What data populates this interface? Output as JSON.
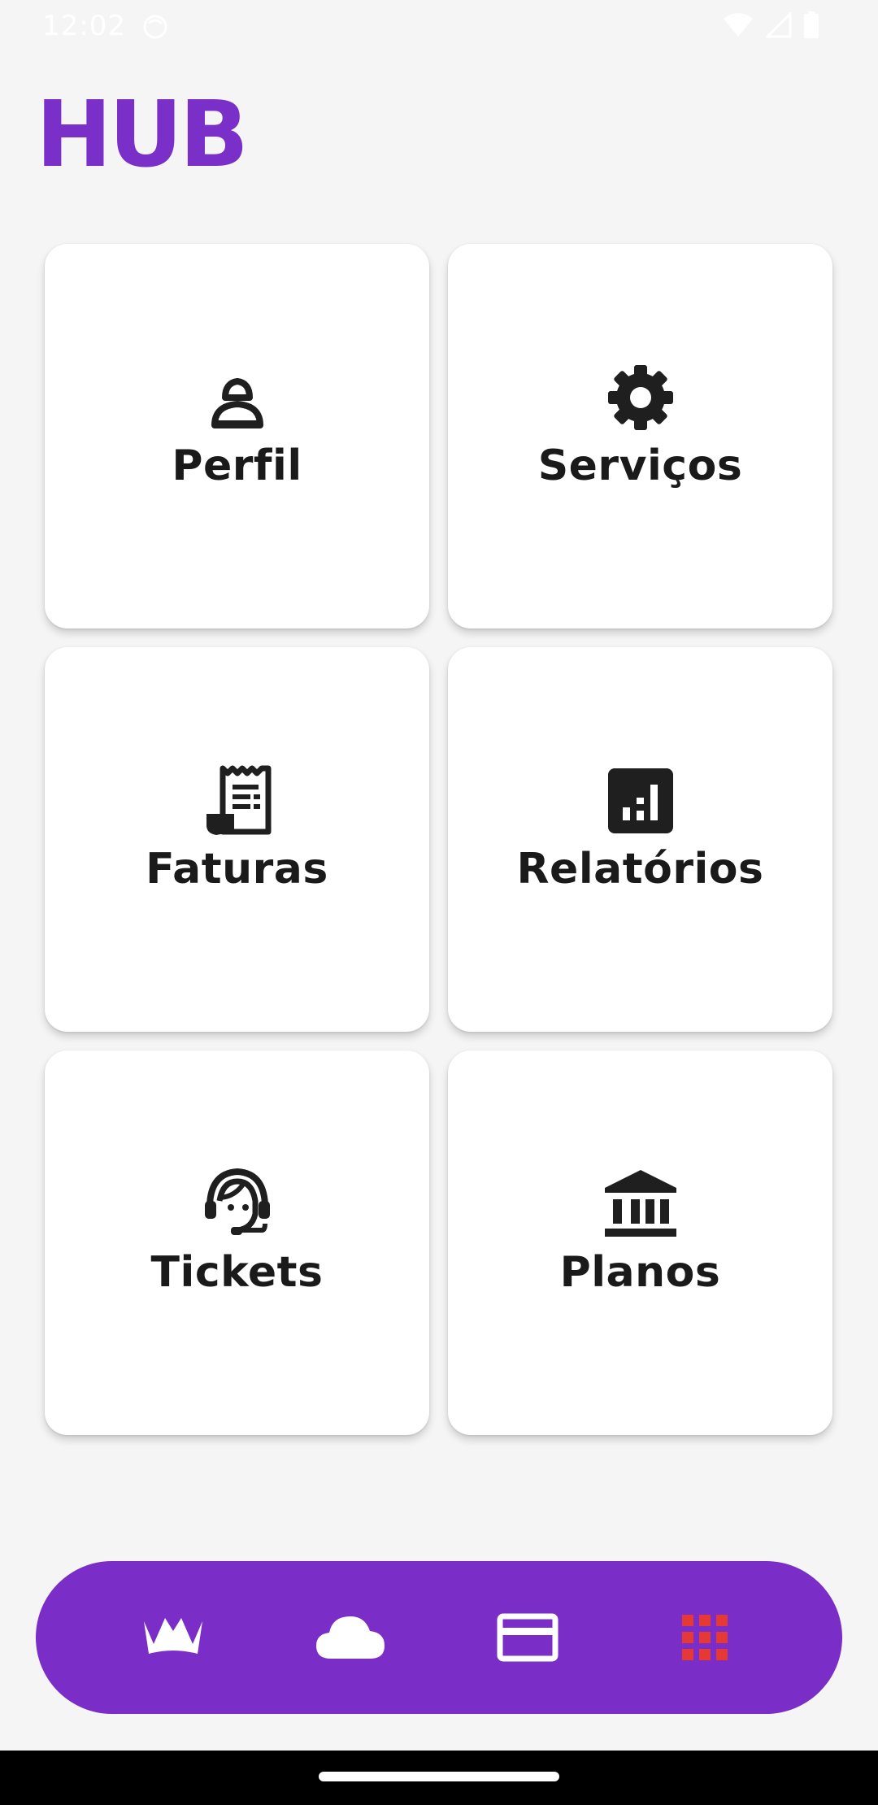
{
  "status_bar": {
    "time": "12:02",
    "icons": [
      "face-icon",
      "wifi-icon",
      "signal-icon",
      "battery-icon"
    ]
  },
  "header": {
    "title": "HUB",
    "title_color": "#7b2fc9"
  },
  "cards": [
    {
      "label": "Perfil",
      "icon": "person-icon"
    },
    {
      "label": "Serviços",
      "icon": "gear-icon"
    },
    {
      "label": "Faturas",
      "icon": "receipt-icon"
    },
    {
      "label": "Relatórios",
      "icon": "bar-chart-icon"
    },
    {
      "label": "Tickets",
      "icon": "support-agent-icon"
    },
    {
      "label": "Planos",
      "icon": "bank-icon"
    }
  ],
  "bottom_nav": {
    "background": "#7b2dc8",
    "active_color": "#e53935",
    "items": [
      {
        "icon": "crown-icon",
        "active": false
      },
      {
        "icon": "cloud-icon",
        "active": false
      },
      {
        "icon": "credit-card-icon",
        "active": false
      },
      {
        "icon": "apps-grid-icon",
        "active": true
      }
    ]
  }
}
